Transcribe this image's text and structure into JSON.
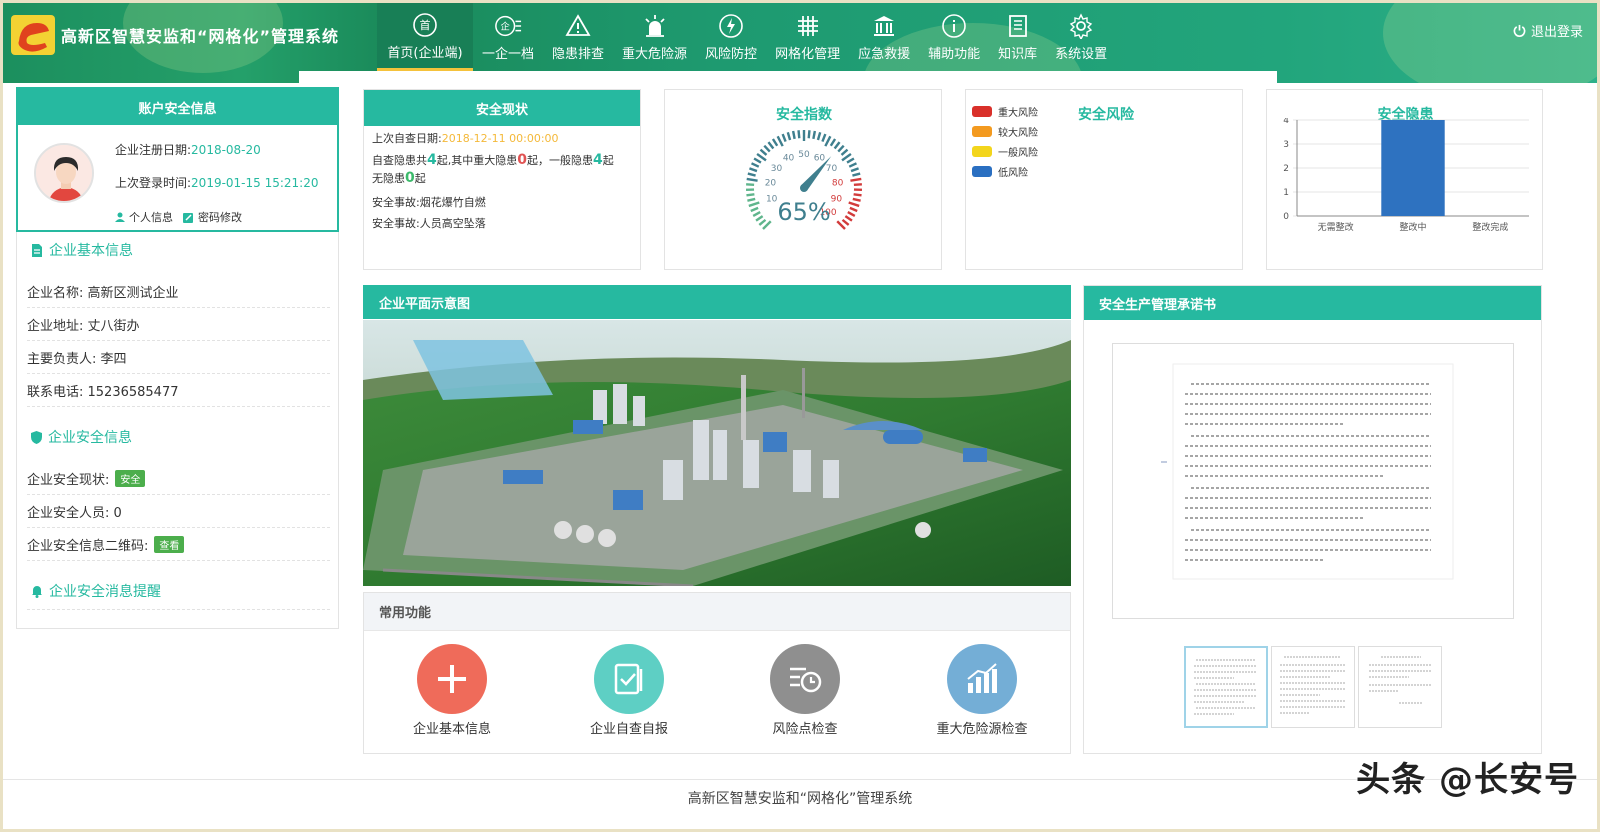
{
  "app": {
    "title": "高新区智慧安监和“网格化”管理系统",
    "logout": "退出登录"
  },
  "nav": [
    {
      "label": "首页(企业端)",
      "icon": "home-icon",
      "active": true
    },
    {
      "label": "一企一档",
      "icon": "company-file-icon"
    },
    {
      "label": "隐患排查",
      "icon": "warning-triangle-icon"
    },
    {
      "label": "重大危险源",
      "icon": "alarm-light-icon"
    },
    {
      "label": "风险防控",
      "icon": "risk-bolt-icon"
    },
    {
      "label": "网格化管理",
      "icon": "grid-icon"
    },
    {
      "label": "应急救援",
      "icon": "building-icon"
    },
    {
      "label": "辅助功能",
      "icon": "info-icon"
    },
    {
      "label": "知识库",
      "icon": "book-icon"
    },
    {
      "label": "系统设置",
      "icon": "gear-icon"
    }
  ],
  "account": {
    "title": "账户安全信息",
    "reg_label": "企业注册日期:",
    "reg_date": "2018-08-20",
    "login_label": "上次登录时间:",
    "login_time": "2019-01-15 15:21:20",
    "profile": "个人信息",
    "password": "密码修改"
  },
  "basic": {
    "title": "企业基本信息",
    "rows": [
      "企业名称: 高新区测试企业",
      "企业地址: 丈八街办",
      "主要负责人: 李四",
      "联系电话: 15236585477"
    ]
  },
  "safety_info": {
    "title": "企业安全信息",
    "status_label": "企业安全现状:",
    "status_tag": "安全",
    "staff": "企业安全人员: 0",
    "qr_label": "企业安全信息二维码:",
    "qr_tag": "查看"
  },
  "messages": {
    "title": "企业安全消息提醒"
  },
  "status_panel": {
    "title": "安全现状",
    "last_label": "上次自查日期:",
    "last_date": "2018-12-11 00:00:00",
    "hz_a": "自查隐患共",
    "hz_total": "4",
    "hz_b": "起,其中重大隐患",
    "hz_major": "0",
    "hz_c": "起，一般隐患",
    "hz_general": "4",
    "hz_d": "起",
    "none_a": "无隐患",
    "none_count": "0",
    "none_b": "起",
    "accident1": "安全事故:烟花爆竹自燃",
    "accident2": "安全事故:人员高空坠落"
  },
  "index_panel": {
    "title": "安全指数",
    "value": 65,
    "value_text": "65%",
    "ticks": [
      "10",
      "20",
      "30",
      "40",
      "50",
      "60",
      "70",
      "80",
      "90",
      "100"
    ]
  },
  "risk_panel": {
    "title": "安全风险",
    "legend": [
      {
        "label": "重大风险",
        "color": "#d9302a"
      },
      {
        "label": "较大风险",
        "color": "#f39a1f"
      },
      {
        "label": "一般风险",
        "color": "#f3d51c"
      },
      {
        "label": "低风险",
        "color": "#2a6fc1"
      }
    ]
  },
  "chart_data": {
    "type": "bar",
    "title": "安全隐患",
    "categories": [
      "无需整改",
      "整改中",
      "整改完成"
    ],
    "values": [
      0,
      4,
      0
    ],
    "ylim": [
      0,
      4
    ],
    "yticks": [
      "0",
      "1",
      "2",
      "3",
      "4"
    ],
    "color": "#2e72c0"
  },
  "plan": {
    "title": "企业平面示意图"
  },
  "common": {
    "title": "常用功能",
    "items": [
      {
        "label": "企业基本信息",
        "icon": "plus-icon",
        "color": "#ef6b5a"
      },
      {
        "label": "企业自查自报",
        "icon": "clipboard-check-icon",
        "color": "#5ecfc4"
      },
      {
        "label": "风险点检查",
        "icon": "list-clock-icon",
        "color": "#8f8f8f"
      },
      {
        "label": "重大危险源检查",
        "icon": "bar-chart-icon",
        "color": "#74aed6"
      }
    ]
  },
  "commit": {
    "title": "安全生产管理承诺书"
  },
  "footer": {
    "text": "高新区智慧安监和“网格化”管理系统",
    "watermark": "头条 @长安号"
  }
}
